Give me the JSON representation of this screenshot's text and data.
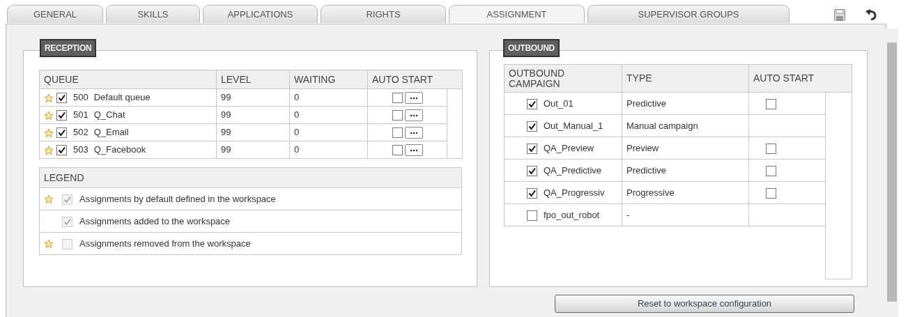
{
  "tabs": [
    {
      "label": "GENERAL",
      "selected": false
    },
    {
      "label": "SKILLS",
      "selected": false
    },
    {
      "label": "APPLICATIONS",
      "selected": false
    },
    {
      "label": "RIGHTS",
      "selected": false
    },
    {
      "label": "ASSIGNMENT",
      "selected": true
    },
    {
      "label": "SUPERVISOR GROUPS",
      "selected": false
    }
  ],
  "reception": {
    "title": "RECEPTION",
    "columns": [
      "QUEUE",
      "LEVEL",
      "WAITING",
      "AUTO START"
    ],
    "rows": [
      {
        "default": true,
        "checked": true,
        "number": "500",
        "name": "Default queue",
        "level": "99",
        "waiting": "0",
        "auto_start": false
      },
      {
        "default": true,
        "checked": true,
        "number": "501",
        "name": "Q_Chat",
        "level": "99",
        "waiting": "0",
        "auto_start": false
      },
      {
        "default": true,
        "checked": true,
        "number": "502",
        "name": "Q_Email",
        "level": "99",
        "waiting": "0",
        "auto_start": false
      },
      {
        "default": true,
        "checked": true,
        "number": "503",
        "name": "Q_Facebook",
        "level": "99",
        "waiting": "0",
        "auto_start": false
      }
    ]
  },
  "legend": {
    "title": "LEGEND",
    "items": [
      {
        "default": true,
        "checked": true,
        "text": "Assignments by default defined in the workspace"
      },
      {
        "default": false,
        "checked": true,
        "text": "Assignments added to the workspace"
      },
      {
        "default": true,
        "checked": false,
        "text": "Assignments removed from the workspace"
      }
    ]
  },
  "outbound": {
    "title": "OUTBOUND",
    "columns": [
      "OUTBOUND CAMPAIGN",
      "TYPE",
      "AUTO START"
    ],
    "rows": [
      {
        "checked": true,
        "name": "Out_01",
        "type": "Predictive",
        "auto_start": false
      },
      {
        "checked": true,
        "name": "Out_Manual_1",
        "type": "Manual campaign"
      },
      {
        "checked": true,
        "name": "QA_Preview",
        "type": "Preview",
        "auto_start": false
      },
      {
        "checked": true,
        "name": "QA_Predictive",
        "type": "Predictive",
        "auto_start": false
      },
      {
        "checked": true,
        "name": "QA_Progressiv",
        "type": "Progressive",
        "auto_start": false
      },
      {
        "checked": false,
        "name": "fpo_out_robot",
        "type": "-"
      }
    ]
  },
  "reset_button": "Reset to workspace configuration"
}
